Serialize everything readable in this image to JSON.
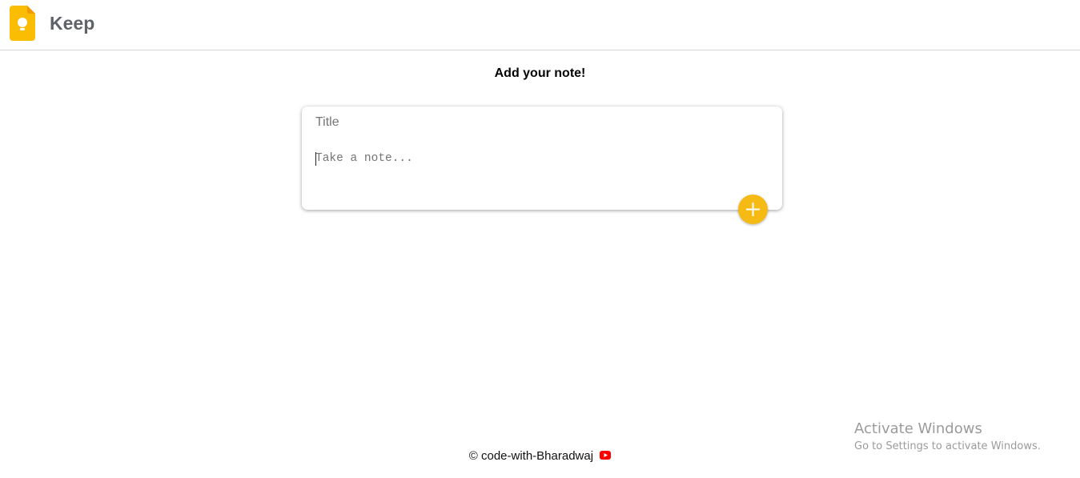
{
  "header": {
    "app_name": "Keep",
    "logo_icon": "keep-bulb-icon",
    "logo_color": "#fbbc04"
  },
  "main": {
    "heading": "Add your note!",
    "title_placeholder": "Title",
    "note_placeholder": "Take a note...",
    "add_button_icon": "plus-icon",
    "accent_color": "#f5ba13"
  },
  "footer": {
    "text": "© code-with-Bharadwaj",
    "icon": "youtube-icon"
  },
  "watermark": {
    "title": "Activate Windows",
    "subtitle": "Go to Settings to activate Windows."
  }
}
